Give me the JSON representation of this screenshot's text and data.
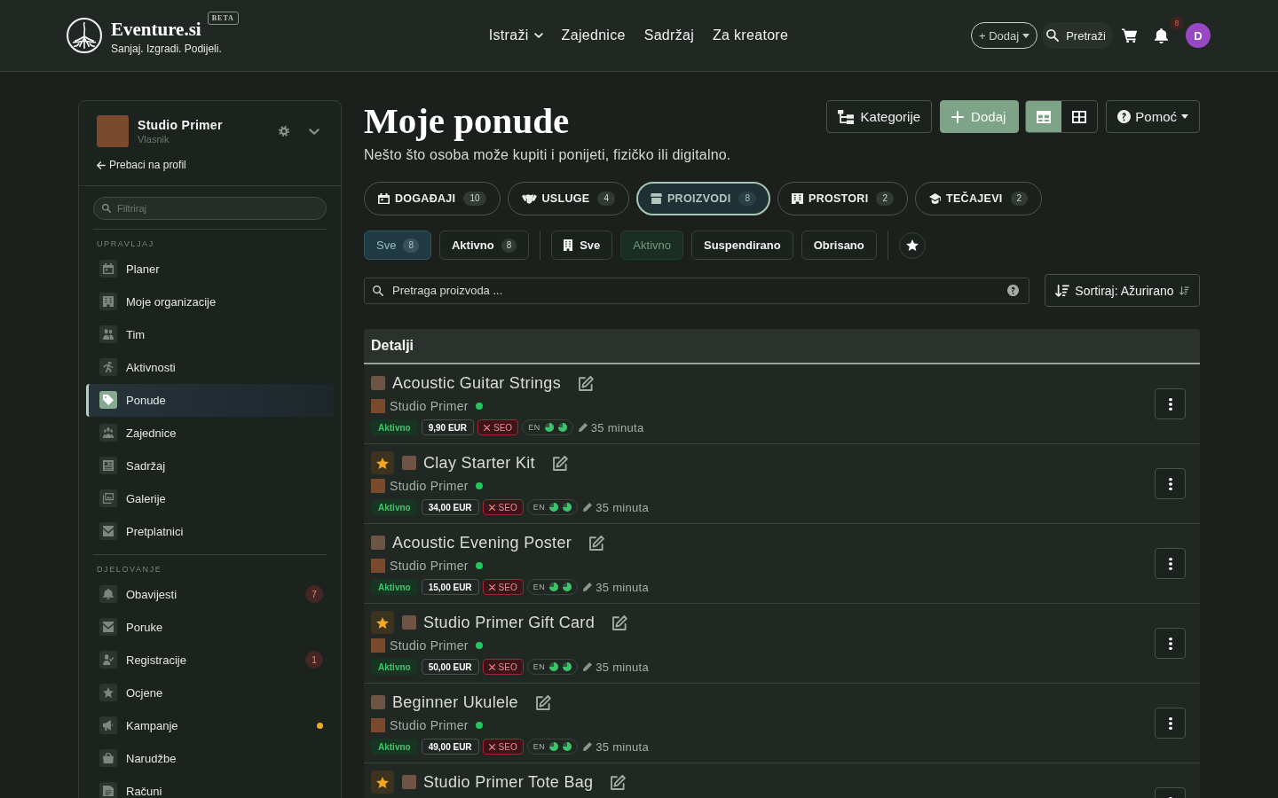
{
  "header": {
    "brand": {
      "name": "Eventure.si",
      "badge": "BETA",
      "tagline": "Sanjaj. Izgradi. Podijeli."
    },
    "nav": [
      {
        "label": "Istraži",
        "dropdown": true
      },
      {
        "label": "Zajednice",
        "dropdown": false
      },
      {
        "label": "Sadržaj",
        "dropdown": false
      },
      {
        "label": "Za kreatore",
        "dropdown": false
      }
    ],
    "add_button": "+ Dodaj",
    "search_button": "Pretraži",
    "notification_count": "8",
    "avatar_initial": "D"
  },
  "sidebar": {
    "profile": {
      "name": "Studio Primer",
      "role": "Vlasnik",
      "switch_link": "Prebaci na profil"
    },
    "filter": {
      "placeholder": "Filtriraj"
    },
    "sections": [
      {
        "title": "UPRAVLJAJ",
        "items": [
          {
            "label": "Planer",
            "selected": false
          },
          {
            "label": "Moje organizacije",
            "selected": false
          },
          {
            "label": "Tim",
            "selected": false
          },
          {
            "label": "Aktivnosti",
            "selected": false
          },
          {
            "label": "Ponude",
            "selected": true
          },
          {
            "label": "Zajednice",
            "selected": false
          },
          {
            "label": "Sadržaj",
            "selected": false
          },
          {
            "label": "Galerije",
            "selected": false
          },
          {
            "label": "Pretplatnici",
            "selected": false
          }
        ]
      },
      {
        "title": "DJELOVANJE",
        "items": [
          {
            "label": "Obavijesti",
            "selected": false,
            "badge": "7",
            "dot": false
          },
          {
            "label": "Poruke",
            "selected": false,
            "dot": false
          },
          {
            "label": "Registracije",
            "selected": false,
            "badge": "1",
            "dot": false
          },
          {
            "label": "Ocjene",
            "selected": false,
            "dot": false
          },
          {
            "label": "Kampanje",
            "selected": false,
            "dot": true
          },
          {
            "label": "Narudžbe",
            "selected": false,
            "dot": false
          },
          {
            "label": "Računi",
            "selected": false,
            "dot": false
          }
        ]
      }
    ]
  },
  "page": {
    "title": "Moje ponude",
    "subtitle": "Nešto što osoba može kupiti i ponijeti, fizičko ili digitalno.",
    "actions": {
      "categories": "Kategorije",
      "add": "Dodaj",
      "view_modes": [
        {
          "selected": true
        },
        {
          "selected": false
        }
      ],
      "help": "Pomoć"
    }
  },
  "type_tabs": [
    {
      "label": "DOGAĐAJI",
      "count": "10",
      "selected": false
    },
    {
      "label": "USLUGE",
      "count": "4",
      "selected": false
    },
    {
      "label": "PROIZVODI",
      "count": "8",
      "selected": true
    },
    {
      "label": "PROSTORI",
      "count": "2",
      "selected": false
    },
    {
      "label": "TEČAJEVI",
      "count": "2",
      "selected": false
    }
  ],
  "scope_filters": [
    {
      "label": "Sve",
      "count": "8",
      "selected": true
    },
    {
      "label": "Aktivno",
      "count": "8",
      "selected": false
    }
  ],
  "status_filters": [
    {
      "label": "Sve",
      "selected": false
    },
    {
      "label": "Aktivno",
      "selected": true
    },
    {
      "label": "Suspendirano",
      "selected": false
    },
    {
      "label": "Obrisano",
      "selected": false
    }
  ],
  "search": {
    "placeholder": "Pretraga proizvoda ..."
  },
  "sort_button": "Sortiraj: Ažurirano",
  "list": {
    "header": "Detalji",
    "rows": [
      {
        "name": "Acoustic Guitar Strings",
        "starred": false,
        "owner": "Studio Primer",
        "online": true,
        "status": "Aktivno",
        "price": "9,90 EUR",
        "seo": {
          "label": "SEO",
          "ok": false
        },
        "language": "EN",
        "reading_time": "35 minuta"
      },
      {
        "name": "Clay Starter Kit",
        "starred": true,
        "owner": "Studio Primer",
        "online": true,
        "status": "Aktivno",
        "price": "34,00 EUR",
        "seo": {
          "label": "SEO",
          "ok": false
        },
        "language": "EN",
        "reading_time": "35 minuta"
      },
      {
        "name": "Acoustic Evening Poster",
        "starred": false,
        "owner": "Studio Primer",
        "online": true,
        "status": "Aktivno",
        "price": "15,00 EUR",
        "seo": {
          "label": "SEO",
          "ok": false
        },
        "language": "EN",
        "reading_time": "35 minuta"
      },
      {
        "name": "Studio Primer Gift Card",
        "starred": true,
        "owner": "Studio Primer",
        "online": true,
        "status": "Aktivno",
        "price": "50,00 EUR",
        "seo": {
          "label": "SEO",
          "ok": false
        },
        "language": "EN",
        "reading_time": "35 minuta"
      },
      {
        "name": "Beginner Ukulele",
        "starred": false,
        "owner": "Studio Primer",
        "online": true,
        "status": "Aktivno",
        "price": "49,00 EUR",
        "seo": {
          "label": "SEO",
          "ok": false
        },
        "language": "EN",
        "reading_time": "35 minuta"
      },
      {
        "name": "Studio Primer Tote Bag",
        "starred": true
      }
    ]
  }
}
